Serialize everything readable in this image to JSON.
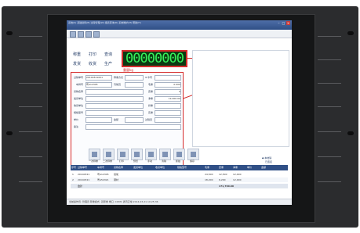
{
  "window": {
    "menu_text": "系统(S)  基础资料(B)  过磅管理(W)  报表查询(R)  系统维护(M)  帮助(H)",
    "minimize": "–",
    "maximize": "□",
    "close": "×"
  },
  "nav": {
    "row1": [
      "称重",
      "打印",
      "查询"
    ],
    "row2": [
      "发货",
      "收货",
      "生产"
    ]
  },
  "display": {
    "value": "00000000",
    "unit": "重量kg"
  },
  "annotations": {
    "display_note": "仪表数据显示区域",
    "form_note_1": "所有称重信息设置填",
    "form_note_2": "写或者选取下拉菜单",
    "form_note_3": "选择"
  },
  "form": {
    "labels": {
      "weigh_no": "过磅单号",
      "vehicle": "车牌号",
      "card_no": "IC卡号",
      "driver": "驾驶员",
      "goods": "货物名称",
      "sender": "发货单位",
      "receiver": "收货单位",
      "spec": "规格型号",
      "unit_price": "单价",
      "gross": "毛重",
      "tare": "皮重",
      "net": "净重",
      "deduct": "扣重",
      "actual": "实重",
      "amount": "金额",
      "operator": "过磅员",
      "remark": "备注",
      "mode": "称重方式"
    },
    "values": {
      "weigh_no": "20140321001",
      "vehicle": "粤A12345",
      "gross": "0.000",
      "tare": "0",
      "net": "12,000.00"
    }
  },
  "actions": [
    "一次称重",
    "二次称重",
    "打印",
    "预览",
    "手动",
    "清除",
    "抓拍",
    "保存"
  ],
  "side_panel": {
    "line1": "◆ 本地磅",
    "line2": "已连接"
  },
  "table": {
    "headers": [
      "序号",
      "过磅单号",
      "车牌号",
      "货物名称",
      "发货单位",
      "收货单位",
      "规格型号",
      "毛重",
      "皮重",
      "净重",
      "单价",
      "金额"
    ],
    "rows": [
      [
        "1",
        "20140321",
        "粤A12345",
        "煤炭",
        "",
        "",
        "",
        "24,500",
        "12,500",
        "12,000",
        "",
        ""
      ],
      [
        "2",
        "20140321",
        "粤A54321",
        "钢材",
        "",
        "",
        "",
        "18,200",
        "6,200",
        "12,000",
        "",
        ""
      ]
    ],
    "total_label": "合计",
    "total_value": "171,760.00"
  },
  "status": {
    "text": "当前操作员: 管理员  称重模式: 双称重  端口: COM1  通讯正常  2014-03-21 10:25:36"
  }
}
